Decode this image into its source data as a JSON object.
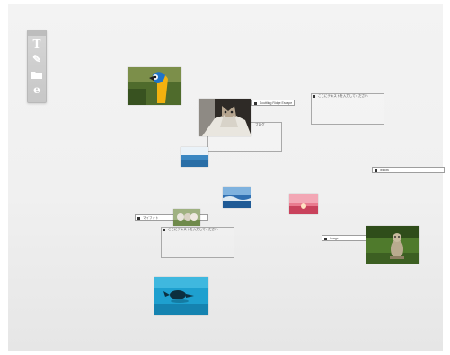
{
  "toolbar": {
    "buttons": [
      {
        "icon": "text-tool-icon",
        "glyph": "T"
      },
      {
        "icon": "pencil-tool-icon",
        "glyph": "✎"
      },
      {
        "icon": "folder-tool-icon",
        "glyph": ""
      },
      {
        "icon": "web-tool-icon",
        "glyph": "e"
      }
    ]
  },
  "notes": {
    "cat_title": "Scuttling Ridge Escape",
    "cat_sub": "ブログ",
    "topright": "ここにテキストを入力してください",
    "far_right": "ibidow",
    "left_title": "マイフォト",
    "bottom": "ここにテキストを入力してください",
    "squirrel": "Image"
  },
  "colors": {
    "canvas_bg": "#f0f0f0",
    "note_border": "#a9a9a9"
  }
}
